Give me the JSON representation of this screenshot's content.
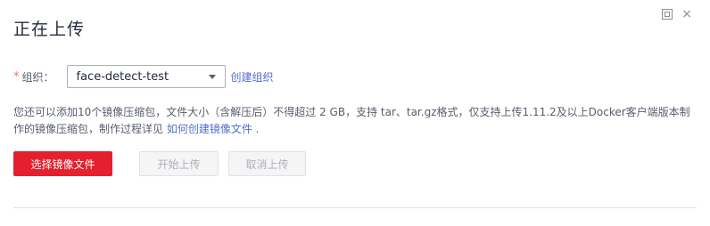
{
  "dialog": {
    "title": "正在上传",
    "icons": {
      "fullscreen": "fullscreen-icon",
      "close": "close-icon"
    },
    "close_glyph": "×"
  },
  "form": {
    "required_mark": "*",
    "org_label": "组织：",
    "org_selected": "face-detect-test",
    "create_org_link": "创建组织"
  },
  "description": {
    "text": "您还可以添加10个镜像压缩包，文件大小（含解压后）不得超过 2 GB，支持 tar、tar.gz格式，仅支持上传1.11.2及以上Docker客户端版本制作的镜像压缩包，制作过程详见 ",
    "link": "如何创建镜像文件",
    "suffix": " ."
  },
  "buttons": {
    "select_files": "选择镜像文件",
    "start_upload": "开始上传",
    "cancel_upload": "取消上传"
  },
  "colors": {
    "primary": "#e5202e",
    "link": "#526ecc",
    "required": "#f66f6a"
  }
}
